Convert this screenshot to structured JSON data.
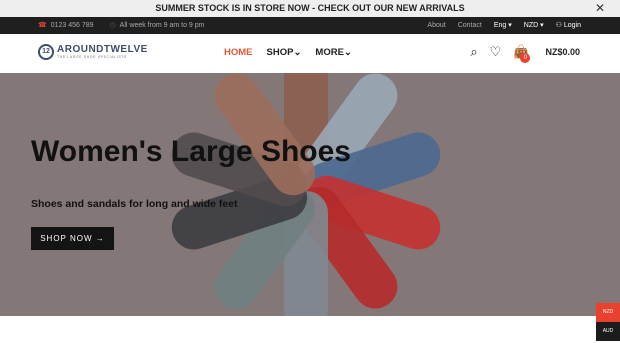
{
  "announcement": {
    "text": "SUMMER STOCK IS IN STORE NOW - CHECK OUT OUR NEW ARRIVALS",
    "close_icon": "close-icon"
  },
  "topbar": {
    "phone": "0123 456 789",
    "hours": "All week from 9 am to 9 pm",
    "links": [
      "About",
      "Contact"
    ],
    "language": "Eng",
    "currency": "NZD",
    "login": "Login"
  },
  "header": {
    "logo_text": "AROUNDTWELVE",
    "logo_sub": "THE LARGE SHOE SPECIALISTS",
    "logo_mark": "12",
    "nav": {
      "home": "HOME",
      "shop": "SHOP",
      "more": "MORE"
    },
    "cart_count": "0",
    "cart_total": "NZ$0.00"
  },
  "hero": {
    "title": "Women's Large Shoes",
    "subtitle": "Shoes and sandals for long and wide feet",
    "button": "SHOP NOW",
    "shoe_colors": [
      "#8b5e4f",
      "#9aa7b6",
      "#4b6890",
      "#c43131",
      "#b52a2a",
      "#7f8890",
      "#707f82",
      "#3c3c40",
      "#524b4e",
      "#9b6d5b"
    ]
  },
  "currency_switch": {
    "nzd": "NZD",
    "aud": "AUD"
  }
}
